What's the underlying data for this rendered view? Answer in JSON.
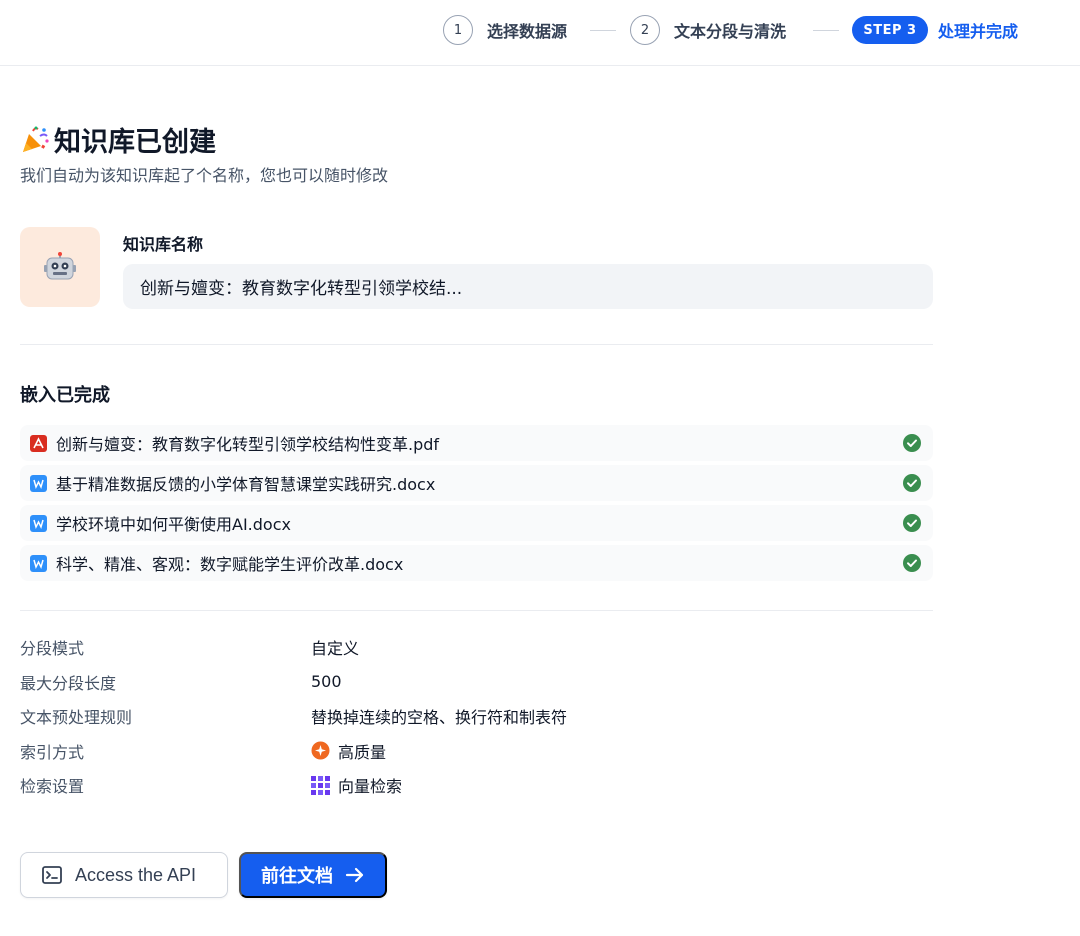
{
  "stepper": {
    "steps": [
      {
        "num": "1",
        "label": "选择数据源"
      },
      {
        "num": "2",
        "label": "文本分段与清洗"
      },
      {
        "badge": "STEP 3",
        "label": "处理并完成"
      }
    ]
  },
  "header": {
    "icon": "party-popper-icon",
    "title": "知识库已创建",
    "subtitle": "我们自动为该知识库起了个名称，您也可以随时修改"
  },
  "knowledge_base": {
    "avatar_icon": "robot-icon",
    "name_label": "知识库名称",
    "name_value": "创新与嬗变：教育数字化转型引领学校结..."
  },
  "embedding": {
    "title": "嵌入已完成",
    "files": [
      {
        "icon": "pdf-file-icon",
        "name": "创新与嬗变：教育数字化转型引领学校结构性变革.pdf",
        "status": "completed"
      },
      {
        "icon": "word-file-icon",
        "name": "基于精准数据反馈的小学体育智慧课堂实践研究.docx",
        "status": "completed"
      },
      {
        "icon": "word-file-icon",
        "name": "学校环境中如何平衡使用AI.docx",
        "status": "completed"
      },
      {
        "icon": "word-file-icon",
        "name": "科学、精准、客观：数字赋能学生评价改革.docx",
        "status": "completed"
      }
    ]
  },
  "settings": [
    {
      "key": "分段模式",
      "value": "自定义"
    },
    {
      "key": "最大分段长度",
      "value": "500"
    },
    {
      "key": "文本预处理规则",
      "value": "替换掉连续的空格、换行符和制表符"
    },
    {
      "key": "索引方式",
      "value": "高质量",
      "icon": "high-quality-icon"
    },
    {
      "key": "检索设置",
      "value": "向量检索",
      "icon": "vector-search-icon"
    }
  ],
  "actions": {
    "api_label": "Access the API",
    "docs_label": "前往文档"
  },
  "colors": {
    "primary": "#155eef",
    "success": "#079455",
    "pdf": "#d92d20",
    "word": "#2e90fa",
    "avatar_bg": "#fdeadd"
  }
}
